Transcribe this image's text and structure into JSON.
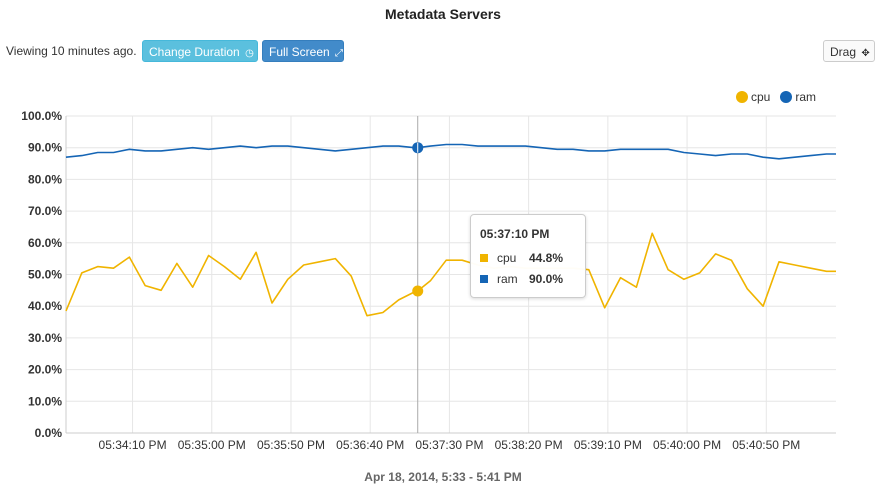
{
  "header": {
    "title": "Metadata Servers",
    "viewing_text": "Viewing 10 minutes ago.",
    "change_duration_label": "Change Duration",
    "full_screen_label": "Full Screen",
    "drag_label": "Drag"
  },
  "tooltip": {
    "time": "05:37:10 PM",
    "rows": [
      {
        "label": "cpu",
        "value": "44.8%"
      },
      {
        "label": "ram",
        "value": "90.0%"
      }
    ]
  },
  "colors": {
    "cpu": "#f0b400",
    "ram": "#1565b5",
    "grid": "#e6e6e6",
    "axis_text": "#333333",
    "crosshair": "#aaaaaa"
  },
  "chart_data": {
    "type": "line",
    "xlabel": "Apr 18, 2014, 5:33 - 5:41 PM",
    "ylabel": "",
    "ylim": [
      0,
      100
    ],
    "y_ticks": [
      "0.0%",
      "10.0%",
      "20.0%",
      "30.0%",
      "40.0%",
      "50.0%",
      "60.0%",
      "70.0%",
      "80.0%",
      "90.0%",
      "100.0%"
    ],
    "x_ticks": [
      "05:34:10 PM",
      "05:35:00 PM",
      "05:35:50 PM",
      "05:36:40 PM",
      "05:37:30 PM",
      "05:38:20 PM",
      "05:39:10 PM",
      "05:40:00 PM",
      "05:40:50 PM"
    ],
    "x_tick_seconds": [
      250,
      300,
      350,
      400,
      450,
      500,
      550,
      600,
      650
    ],
    "x_range_seconds": [
      208,
      694
    ],
    "legend_position": "top-right",
    "grid": true,
    "highlight_x_seconds": 430,
    "series": [
      {
        "name": "cpu",
        "x_seconds": [
          208,
          218,
          228,
          238,
          248,
          258,
          268,
          278,
          288,
          298,
          308,
          318,
          328,
          338,
          348,
          358,
          368,
          378,
          388,
          398,
          408,
          418,
          428,
          430,
          438,
          448,
          458,
          468,
          478,
          488,
          498,
          508,
          518,
          528,
          538,
          548,
          558,
          568,
          578,
          588,
          598,
          608,
          618,
          628,
          638,
          648,
          658,
          668,
          678,
          688,
          694
        ],
        "values": [
          38.5,
          50.5,
          52.5,
          52.0,
          55.5,
          46.5,
          45.0,
          53.5,
          46.0,
          56.0,
          52.5,
          48.5,
          57.0,
          41.0,
          48.5,
          53.0,
          54.0,
          55.0,
          49.5,
          37.0,
          38.0,
          42.0,
          44.5,
          44.8,
          48.0,
          54.5,
          54.5,
          53.0,
          52.0,
          52.5,
          52.0,
          52.0,
          52.0,
          52.0,
          51.5,
          39.5,
          49.0,
          46.0,
          63.0,
          51.5,
          48.5,
          50.5,
          56.5,
          54.5,
          45.5,
          40.0,
          54.0,
          53.0,
          52.0,
          51.0,
          51.0
        ]
      },
      {
        "name": "ram",
        "x_seconds": [
          208,
          218,
          228,
          238,
          248,
          258,
          268,
          278,
          288,
          298,
          308,
          318,
          328,
          338,
          348,
          358,
          368,
          378,
          388,
          398,
          408,
          418,
          428,
          430,
          438,
          448,
          458,
          468,
          478,
          488,
          498,
          508,
          518,
          528,
          538,
          548,
          558,
          568,
          578,
          588,
          598,
          608,
          618,
          628,
          638,
          648,
          658,
          668,
          678,
          688,
          694
        ],
        "values": [
          87.0,
          87.5,
          88.5,
          88.5,
          89.5,
          89.0,
          89.0,
          89.5,
          90.0,
          89.5,
          90.0,
          90.5,
          90.0,
          90.5,
          90.5,
          90.0,
          89.5,
          89.0,
          89.5,
          90.0,
          90.5,
          90.5,
          90.0,
          90.0,
          90.5,
          91.0,
          91.0,
          90.5,
          90.5,
          90.5,
          90.5,
          90.0,
          89.5,
          89.5,
          89.0,
          89.0,
          89.5,
          89.5,
          89.5,
          89.5,
          88.5,
          88.0,
          87.5,
          88.0,
          88.0,
          87.0,
          86.5,
          87.0,
          87.5,
          88.0,
          88.0
        ]
      }
    ]
  }
}
